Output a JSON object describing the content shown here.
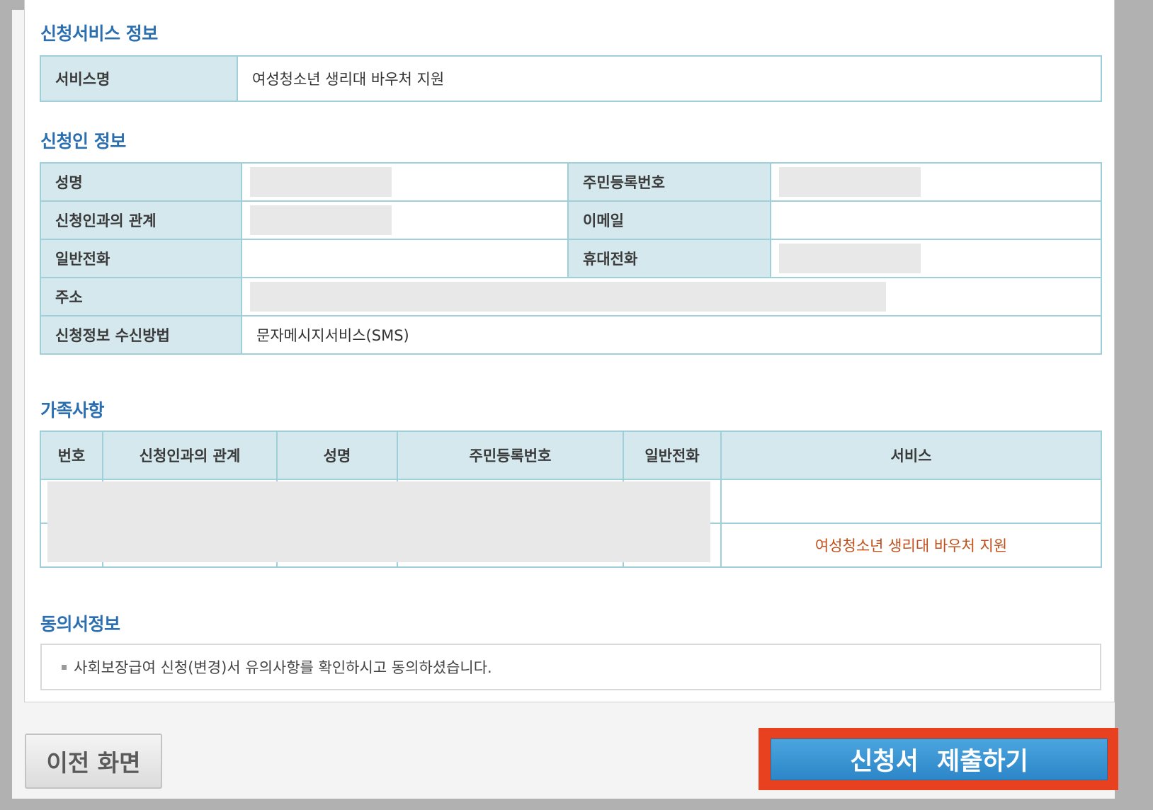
{
  "sections": {
    "service_info": "신청서비스 정보",
    "applicant_info": "신청인 정보",
    "family": "가족사항",
    "consent": "동의서정보"
  },
  "service": {
    "label": "서비스명",
    "value": "여성청소년 생리대 바우처 지원"
  },
  "applicant": {
    "name_label": "성명",
    "rrn_label": "주민등록번호",
    "relation_label": "신청인과의 관계",
    "email_label": "이메일",
    "phone_label": "일반전화",
    "mobile_label": "휴대전화",
    "address_label": "주소",
    "receive_label": "신청정보 수신방법",
    "receive_value": "문자메시지서비스(SMS)"
  },
  "family": {
    "headers": [
      "번호",
      "신청인과의 관계",
      "성명",
      "주민등록번호",
      "일반전화",
      "서비스"
    ],
    "rows": [
      {
        "service": ""
      },
      {
        "service": "여성청소년 생리대 바우처 지원"
      }
    ]
  },
  "consent": {
    "text": "사회보장급여 신청(변경)서 유의사항를 확인하시고 동의하셨습니다."
  },
  "buttons": {
    "prev": "이전 화면",
    "submit": "신청서 제출하기"
  },
  "colors": {
    "section_title": "#2c6fb0",
    "label_bg": "#d4e8ed",
    "border": "#9fcfd8",
    "service_text": "#c0501b",
    "submit_bg": "#2c86c8",
    "highlight_frame": "#e8411f"
  }
}
